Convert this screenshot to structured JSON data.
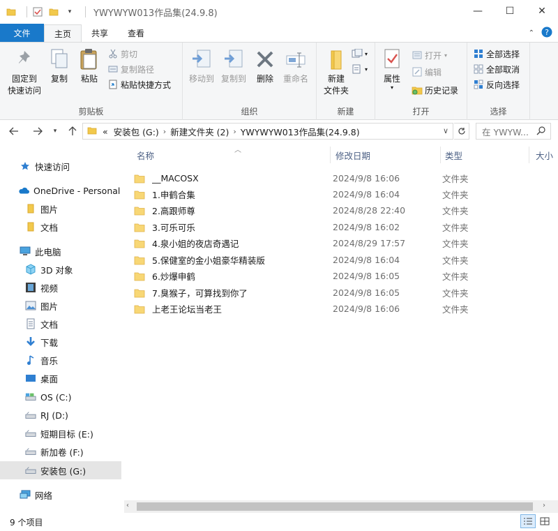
{
  "window": {
    "title": "YWYWYW013作品集(24.9.8)",
    "minimize": "—",
    "maximize": "☐",
    "close": "✕"
  },
  "tabs": [
    {
      "label": "文件"
    },
    {
      "label": "主页"
    },
    {
      "label": "共享"
    },
    {
      "label": "查看"
    }
  ],
  "ribbon": {
    "clipboard": {
      "label": "剪贴板",
      "pin": "固定到\n快速访问",
      "copy": "复制",
      "paste": "粘贴",
      "cut": "剪切",
      "copy_path": "复制路径",
      "paste_shortcut": "粘贴快捷方式"
    },
    "organize": {
      "label": "组织",
      "move_to": "移动到",
      "copy_to": "复制到",
      "delete": "删除",
      "rename": "重命名"
    },
    "new": {
      "label": "新建",
      "new_folder": "新建\n文件夹"
    },
    "open": {
      "label": "打开",
      "properties": "属性",
      "open": "打开",
      "edit": "编辑",
      "history": "历史记录"
    },
    "select": {
      "label": "选择",
      "select_all": "全部选择",
      "select_none": "全部取消",
      "invert": "反向选择"
    }
  },
  "address": {
    "prefix": "«",
    "crumbs": [
      "安装包 (G:)",
      "新建文件夹 (2)",
      "YWYWYW013作品集(24.9.8)"
    ],
    "search_placeholder": "在 YWYW..."
  },
  "nav": [
    {
      "label": "快速访问",
      "icon": "star-icon"
    },
    {
      "label": "OneDrive - Personal",
      "icon": "cloud-icon"
    },
    {
      "label": "图片",
      "icon": "folder-icon"
    },
    {
      "label": "文档",
      "icon": "folder-icon"
    },
    {
      "label": "此电脑",
      "icon": "pc-icon"
    },
    {
      "label": "3D 对象",
      "icon": "cube-icon"
    },
    {
      "label": "视频",
      "icon": "film-icon"
    },
    {
      "label": "图片",
      "icon": "picture-icon"
    },
    {
      "label": "文档",
      "icon": "document-icon"
    },
    {
      "label": "下载",
      "icon": "download-icon"
    },
    {
      "label": "音乐",
      "icon": "music-icon"
    },
    {
      "label": "桌面",
      "icon": "desktop-icon"
    },
    {
      "label": "OS (C:)",
      "icon": "drive-icon"
    },
    {
      "label": "RJ (D:)",
      "icon": "drive-icon"
    },
    {
      "label": "短期目标 (E:)",
      "icon": "drive-icon"
    },
    {
      "label": "新加卷 (F:)",
      "icon": "drive-icon"
    },
    {
      "label": "安装包 (G:)",
      "icon": "drive-icon"
    },
    {
      "label": "网络",
      "icon": "network-icon"
    }
  ],
  "columns": {
    "name": "名称",
    "date": "修改日期",
    "type": "类型",
    "size": "大小"
  },
  "files": [
    {
      "name": "__MACOSX",
      "date": "2024/9/8 16:06",
      "type": "文件夹"
    },
    {
      "name": "1.申鹤合集",
      "date": "2024/9/8 16:04",
      "type": "文件夹"
    },
    {
      "name": "2.高跟师尊",
      "date": "2024/8/28 22:40",
      "type": "文件夹"
    },
    {
      "name": "3.可乐可乐",
      "date": "2024/9/8 16:02",
      "type": "文件夹"
    },
    {
      "name": "4.泉小姐的夜店奇遇记",
      "date": "2024/8/29 17:57",
      "type": "文件夹"
    },
    {
      "name": "5.保健室的金小姐豪华精装版",
      "date": "2024/9/8 16:04",
      "type": "文件夹"
    },
    {
      "name": "6.炒爆申鹤",
      "date": "2024/9/8 16:05",
      "type": "文件夹"
    },
    {
      "name": "7.臭猴子，可算找到你了",
      "date": "2024/9/8 16:05",
      "type": "文件夹"
    },
    {
      "name": "上老王论坛当老王",
      "date": "2024/9/8 16:06",
      "type": "文件夹"
    }
  ],
  "status": {
    "count": "9 个项目"
  },
  "colors": {
    "file_tab": "#1979ca",
    "folder": "#f8d775",
    "selected_nav": "#d9d9d9",
    "column_header": "#4d6185"
  }
}
